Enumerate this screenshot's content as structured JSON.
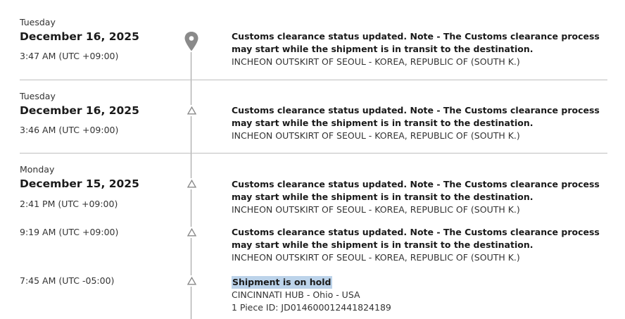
{
  "events": [
    {
      "day": "Tuesday",
      "date": "December 16, 2025",
      "time": "3:47 AM (UTC +09:00)",
      "icon": "location-pin-icon",
      "title": "Customs clearance status updated. Note - The Customs clearance process may start while the shipment is in transit to the destination.",
      "lines": [
        "INCHEON OUTSKIRT OF SEOUL - KOREA, REPUBLIC OF (SOUTH K.)"
      ]
    },
    {
      "day": "Tuesday",
      "date": "December 16, 2025",
      "time": "3:46 AM (UTC +09:00)",
      "icon": "triangle-icon",
      "title": "Customs clearance status updated. Note - The Customs clearance process may start while the shipment is in transit to the destination.",
      "lines": [
        "INCHEON OUTSKIRT OF SEOUL - KOREA, REPUBLIC OF (SOUTH K.)"
      ]
    },
    {
      "day": "Monday",
      "date": "December 15, 2025",
      "time": "2:41 PM (UTC +09:00)",
      "icon": "triangle-icon",
      "title": "Customs clearance status updated. Note - The Customs clearance process may start while the shipment is in transit to the destination.",
      "lines": [
        "INCHEON OUTSKIRT OF SEOUL - KOREA, REPUBLIC OF (SOUTH K.)"
      ]
    },
    {
      "day": "",
      "date": "",
      "time": "9:19 AM (UTC +09:00)",
      "icon": "triangle-icon",
      "title": "Customs clearance status updated. Note - The Customs clearance process may start while the shipment is in transit to the destination.",
      "lines": [
        "INCHEON OUTSKIRT OF SEOUL - KOREA, REPUBLIC OF (SOUTH K.)"
      ]
    },
    {
      "day": "",
      "date": "",
      "time": "7:45 AM (UTC -05:00)",
      "icon": "triangle-icon",
      "title": "Shipment is on hold",
      "title_highlighted": true,
      "lines": [
        "CINCINNATI HUB - Ohio - USA",
        "1 Piece ID: JD014600012441824189"
      ]
    }
  ],
  "colors": {
    "timeline": "#999999",
    "highlight": "#bcd3ea",
    "pin": "#8a8a8a"
  }
}
